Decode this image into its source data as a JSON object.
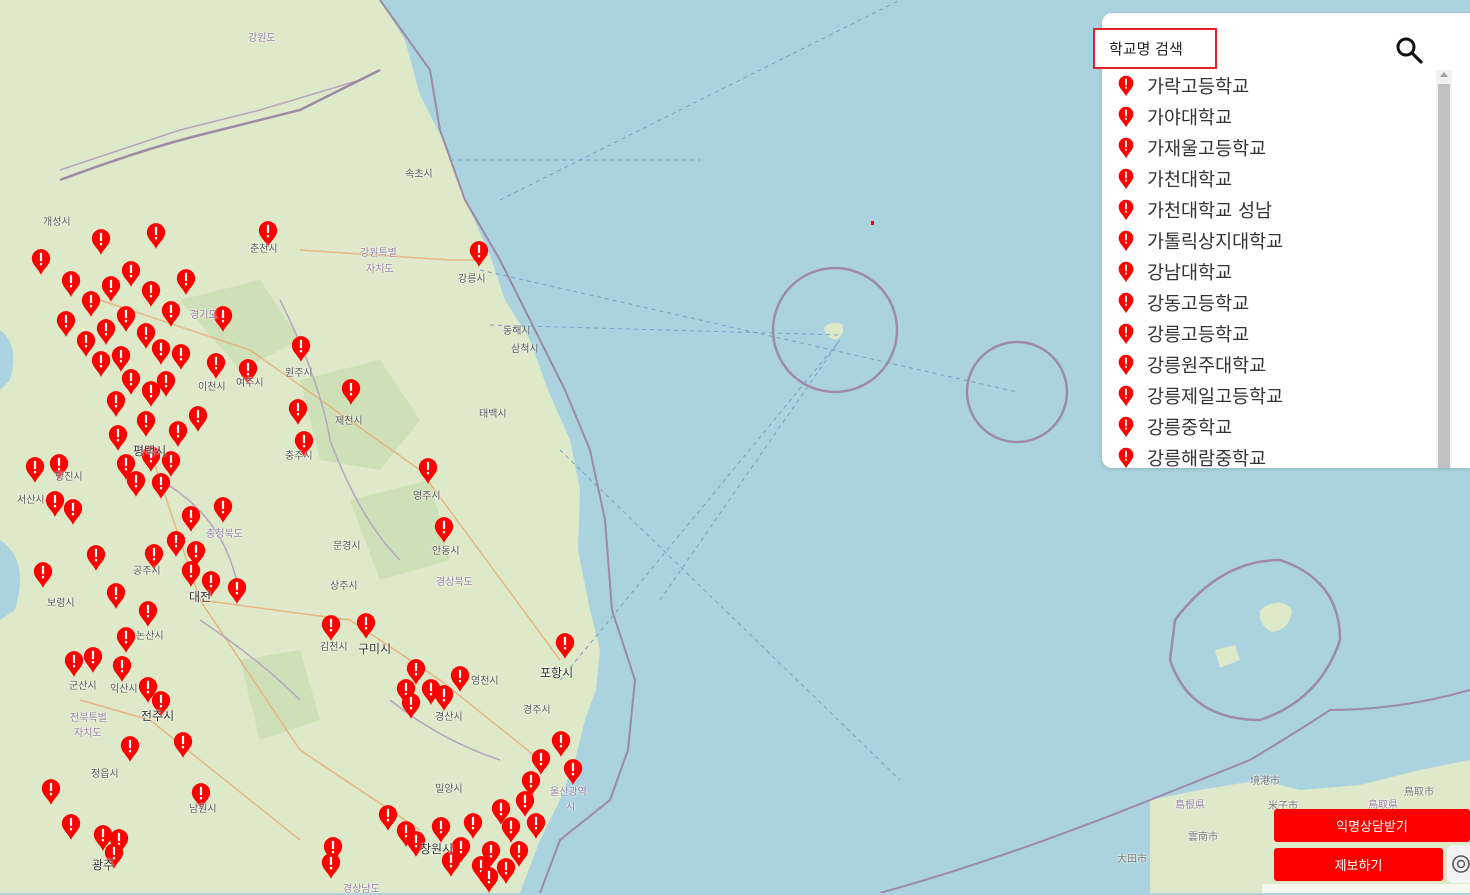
{
  "search": {
    "placeholder": "학교명 검색"
  },
  "school_list": [
    "가락고등학교",
    "가야대학교",
    "가재울고등학교",
    "가천대학교",
    "가천대학교 성남",
    "가톨릭상지대학교",
    "강남대학교",
    "강동고등학교",
    "강릉고등학교",
    "강릉원주대학교",
    "강릉제일고등학교",
    "강릉중학교",
    "강릉해람중학교"
  ],
  "map_labels": [
    "강원도",
    "속초시",
    "개성시",
    "춘천시",
    "강원특별",
    "자치도",
    "강릉시",
    "동해시",
    "삼척시",
    "경기도",
    "이천시",
    "여주시",
    "원주시",
    "제천시",
    "태백시",
    "평택시",
    "충주시",
    "영주시",
    "서산시",
    "당진시",
    "충청북도",
    "안동시",
    "문경시",
    "공주시",
    "대전",
    "보령시",
    "상주시",
    "논산시",
    "김천시",
    "구미시",
    "경상북도",
    "포항시",
    "군산시",
    "익산시",
    "영천시",
    "전주시",
    "전북특별",
    "자치도",
    "경산시",
    "경주시",
    "정읍시",
    "남원시",
    "밀양시",
    "울산광역",
    "시",
    "광주",
    "창원시",
    "경상남도",
    "境港市",
    "島根県",
    "米子市",
    "鳥取県",
    "鳥取市",
    "雲南市",
    "大田市"
  ],
  "buttons": {
    "consult": "익명상담받기",
    "report": "제보하기"
  },
  "colors": {
    "accent": "#ff0000",
    "sea": "#aad3df",
    "land": "#dde9c8",
    "border": "#9e8aa6"
  },
  "icons": {
    "search": "search-icon",
    "list_marker": "map-pin-icon",
    "ai": "chat-ai-icon"
  }
}
